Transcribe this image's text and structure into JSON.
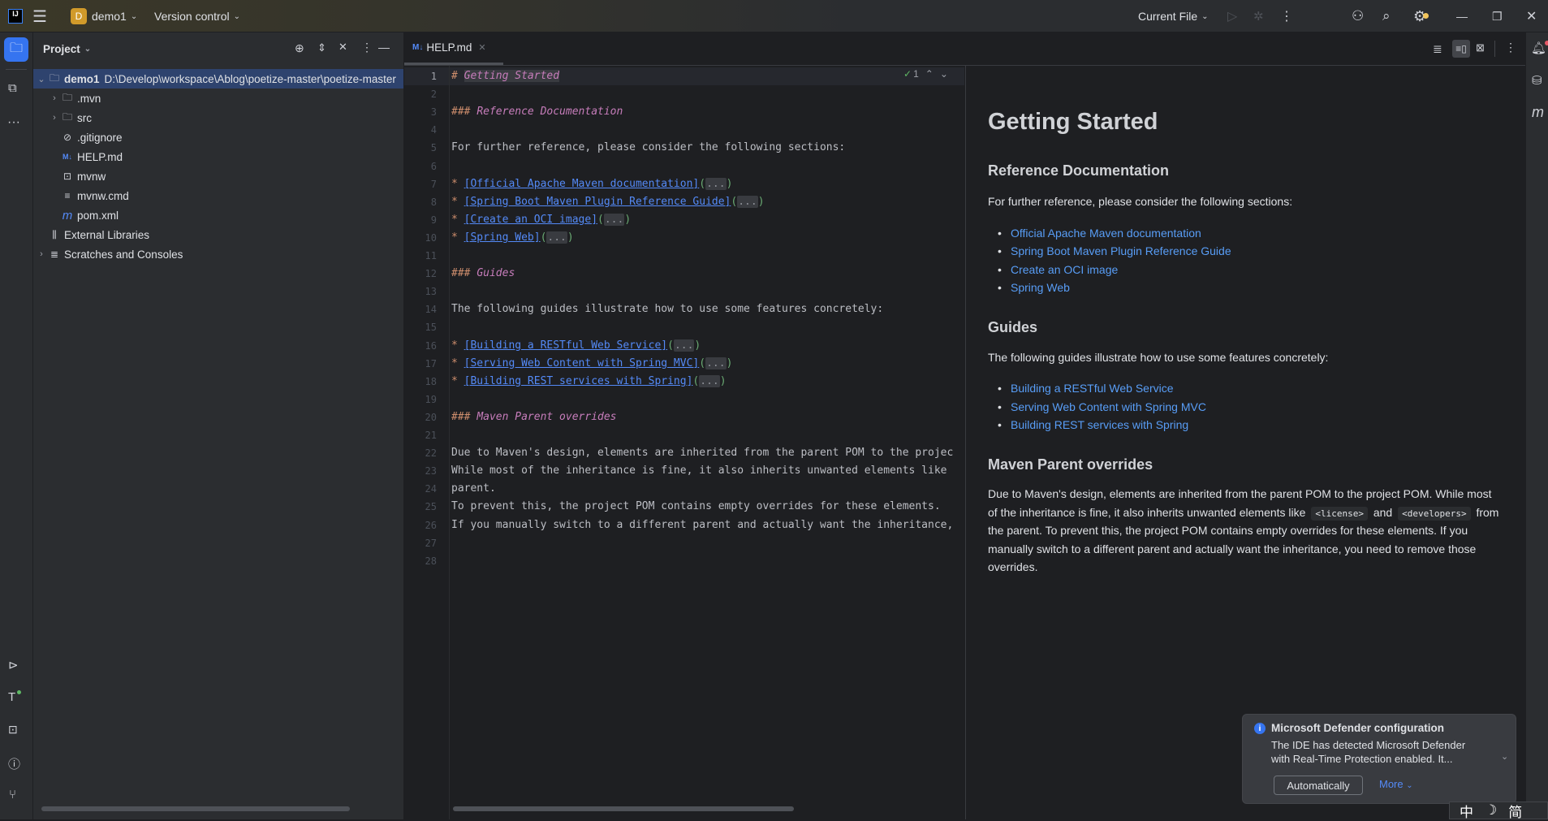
{
  "titlebar": {
    "logo": "IJ",
    "project_badge": "D",
    "project_name": "demo1",
    "vcs": "Version control",
    "run_config": "Current File",
    "accent": "#d19a2a"
  },
  "project_panel": {
    "title": "Project",
    "tree": [
      {
        "name": "demo1",
        "path": "D:\\Develop\\workspace\\Ablog\\poetize-master\\poetize-master",
        "icon": "module-folder-icon",
        "expanded": true,
        "selected": true
      },
      {
        "name": ".mvn",
        "icon": "folder-icon",
        "expandable": true
      },
      {
        "name": "src",
        "icon": "folder-icon",
        "expandable": true
      },
      {
        "name": ".gitignore",
        "icon": "ignore-file-icon"
      },
      {
        "name": "HELP.md",
        "icon": "markdown-icon"
      },
      {
        "name": "mvnw",
        "icon": "shell-icon"
      },
      {
        "name": "mvnw.cmd",
        "icon": "text-file-icon"
      },
      {
        "name": "pom.xml",
        "icon": "maven-icon"
      },
      {
        "name": "External Libraries",
        "icon": "library-icon"
      },
      {
        "name": "Scratches and Consoles",
        "icon": "scratches-icon",
        "expandable": true
      }
    ]
  },
  "editor": {
    "tab": {
      "icon": "M↓",
      "label": "HELP.md"
    },
    "inspection_count": "1",
    "lines": [
      {
        "n": "1",
        "t": "h1",
        "hash": "# ",
        "text": "Getting Started"
      },
      {
        "n": "2",
        "t": "blank"
      },
      {
        "n": "3",
        "t": "h",
        "hash": "### ",
        "text": "Reference Documentation"
      },
      {
        "n": "4",
        "t": "blank"
      },
      {
        "n": "5",
        "t": "p",
        "text": "For further reference, please consider the following sections:"
      },
      {
        "n": "6",
        "t": "blank"
      },
      {
        "n": "7",
        "t": "link",
        "text": "[Official Apache Maven documentation]"
      },
      {
        "n": "8",
        "t": "link",
        "text": "[Spring Boot Maven Plugin Reference Guide]"
      },
      {
        "n": "9",
        "t": "link",
        "text": "[Create an OCI image]"
      },
      {
        "n": "10",
        "t": "link",
        "text": "[Spring Web]"
      },
      {
        "n": "11",
        "t": "blank"
      },
      {
        "n": "12",
        "t": "h",
        "hash": "### ",
        "text": "Guides"
      },
      {
        "n": "13",
        "t": "blank"
      },
      {
        "n": "14",
        "t": "p",
        "text": "The following guides illustrate how to use some features concretely:"
      },
      {
        "n": "15",
        "t": "blank"
      },
      {
        "n": "16",
        "t": "link",
        "text": "[Building a RESTful Web Service]"
      },
      {
        "n": "17",
        "t": "link",
        "text": "[Serving Web Content with Spring MVC]"
      },
      {
        "n": "18",
        "t": "link",
        "text": "[Building REST services with Spring]"
      },
      {
        "n": "19",
        "t": "blank"
      },
      {
        "n": "20",
        "t": "h",
        "hash": "### ",
        "text": "Maven Parent overrides"
      },
      {
        "n": "21",
        "t": "blank"
      },
      {
        "n": "22",
        "t": "p",
        "text": "Due to Maven's design, elements are inherited from the parent POM to the projec"
      },
      {
        "n": "23",
        "t": "p",
        "text": "While most of the inheritance is fine, it also inherits unwanted elements like"
      },
      {
        "n": "24",
        "t": "p",
        "text": "parent."
      },
      {
        "n": "25",
        "t": "p",
        "text": "To prevent this, the project POM contains empty overrides for these elements."
      },
      {
        "n": "26",
        "t": "p",
        "text": "If you manually switch to a different parent and actually want the inheritance,"
      },
      {
        "n": "27",
        "t": "blank"
      },
      {
        "n": "28",
        "t": "blank"
      }
    ]
  },
  "preview": {
    "h1": "Getting Started",
    "ref_heading": "Reference Documentation",
    "ref_intro": "For further reference, please consider the following sections:",
    "ref_links": [
      "Official Apache Maven documentation",
      "Spring Boot Maven Plugin Reference Guide",
      "Create an OCI image",
      "Spring Web"
    ],
    "guides_heading": "Guides",
    "guides_intro": "The following guides illustrate how to use some features concretely:",
    "guide_links": [
      "Building a RESTful Web Service",
      "Serving Web Content with Spring MVC",
      "Building REST services with Spring"
    ],
    "maven_heading": "Maven Parent overrides",
    "maven_p1": "Due to Maven's design, elements are inherited from the parent POM to the project POM. While most",
    "maven_p2a": "of the inheritance is fine, it also inherits unwanted elements like",
    "code1": "<license>",
    "and": "and",
    "code2": "<developers>",
    "maven_p2b": "from",
    "maven_p3": "the parent. To prevent this, the project POM contains empty overrides for these elements. If you",
    "maven_p4": "manually switch to a different parent and actually want the inheritance, you need to remove those",
    "maven_p5": "overrides."
  },
  "notification": {
    "title": "Microsoft Defender configuration",
    "body1": "The IDE has detected Microsoft Defender",
    "body2": "with Real-Time Protection enabled. It...",
    "primary": "Automatically",
    "more": "More"
  },
  "ime": {
    "mode": "中",
    "moon": "☽",
    "simplified": "简"
  }
}
